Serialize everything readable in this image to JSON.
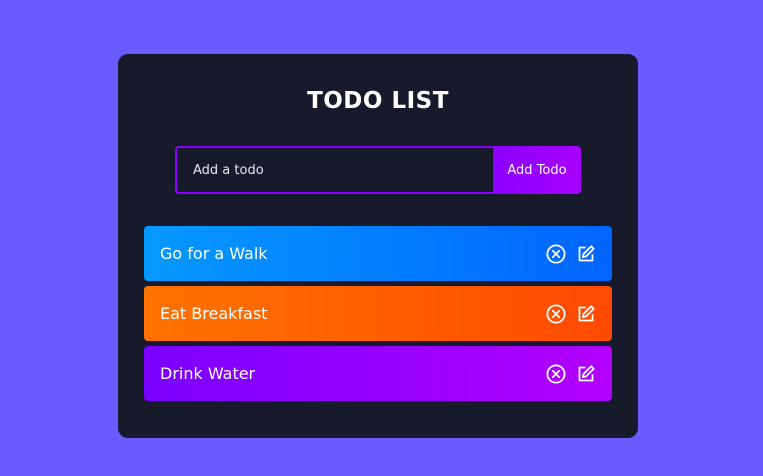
{
  "app": {
    "title": "TODO LIST"
  },
  "form": {
    "placeholder": "Add a todo",
    "button_label": "Add Todo"
  },
  "todos": [
    {
      "text": "Go for a Walk",
      "gradient": [
        "#0599ff",
        "#0065ff"
      ]
    },
    {
      "text": "Eat Breakfast",
      "gradient": [
        "#ff7300",
        "#ff4a00"
      ]
    },
    {
      "text": "Drink Water",
      "gradient": [
        "#7a00ff",
        "#b300ff"
      ]
    }
  ],
  "icons": {
    "delete": "close-circle-icon",
    "edit": "edit-icon"
  },
  "colors": {
    "background": "#6a5bff",
    "panel": "#161a2b",
    "accent": "#8a00ff"
  }
}
